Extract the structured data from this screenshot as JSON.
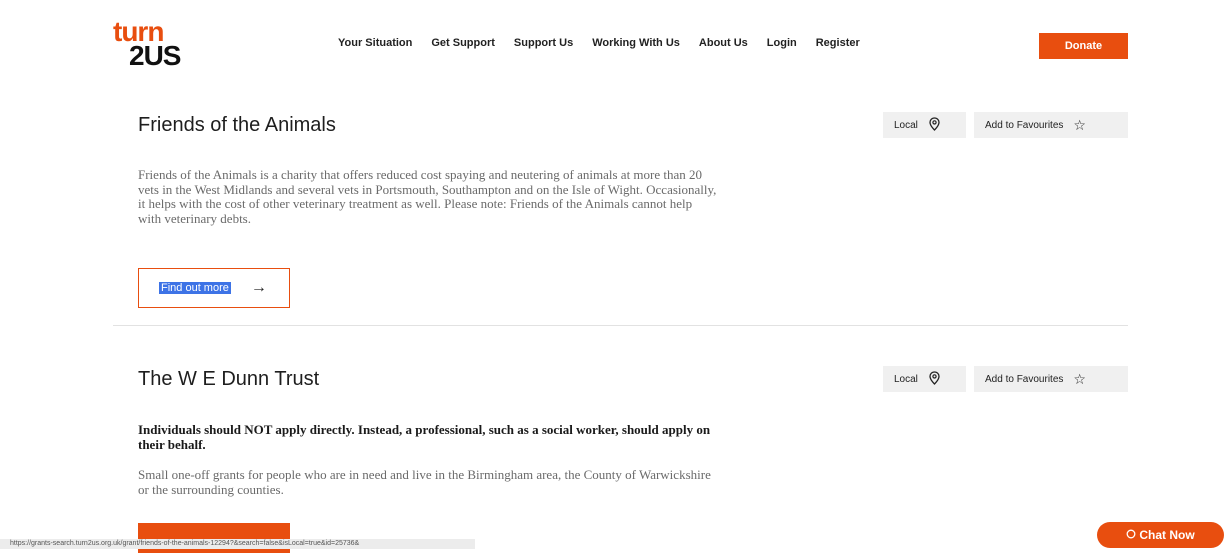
{
  "brand": {
    "line1": "turn",
    "line2": "2US"
  },
  "nav": [
    "Your Situation",
    "Get Support",
    "Support Us",
    "Working With Us",
    "About Us",
    "Login",
    "Register"
  ],
  "donate_label": "Donate",
  "cards": [
    {
      "title": "Friends of the Animals",
      "local_label": "Local",
      "fav_label": "Add to Favourites",
      "description": "Friends of the Animals is a charity that offers reduced cost spaying and neutering of animals at more than 20 vets in the West Midlands and several vets in Portsmouth, Southampton and on the Isle of Wight. Occasionally, it helps with the cost of other veterinary treatment as well. Please note: Friends of the Animals cannot help with veterinary debts.",
      "find_label": "Find out more"
    },
    {
      "title": "The W E Dunn Trust",
      "local_label": "Local",
      "fav_label": "Add to Favourites",
      "notice": "Individuals should NOT apply directly. Instead, a professional, such as a social worker, should apply on their behalf.",
      "description": "Small one-off grants for people who are in need and live in the Birmingham area, the County of Warwickshire or the surrounding counties."
    }
  ],
  "status_url": "https://grants-search.turn2us.org.uk/grant/friends-of-the-animals-12294?&search=false&isLocal=true&id=25736&",
  "chat_label": "Chat Now",
  "colors": {
    "brand": "#e84e0f",
    "selection": "#3d73e6"
  }
}
